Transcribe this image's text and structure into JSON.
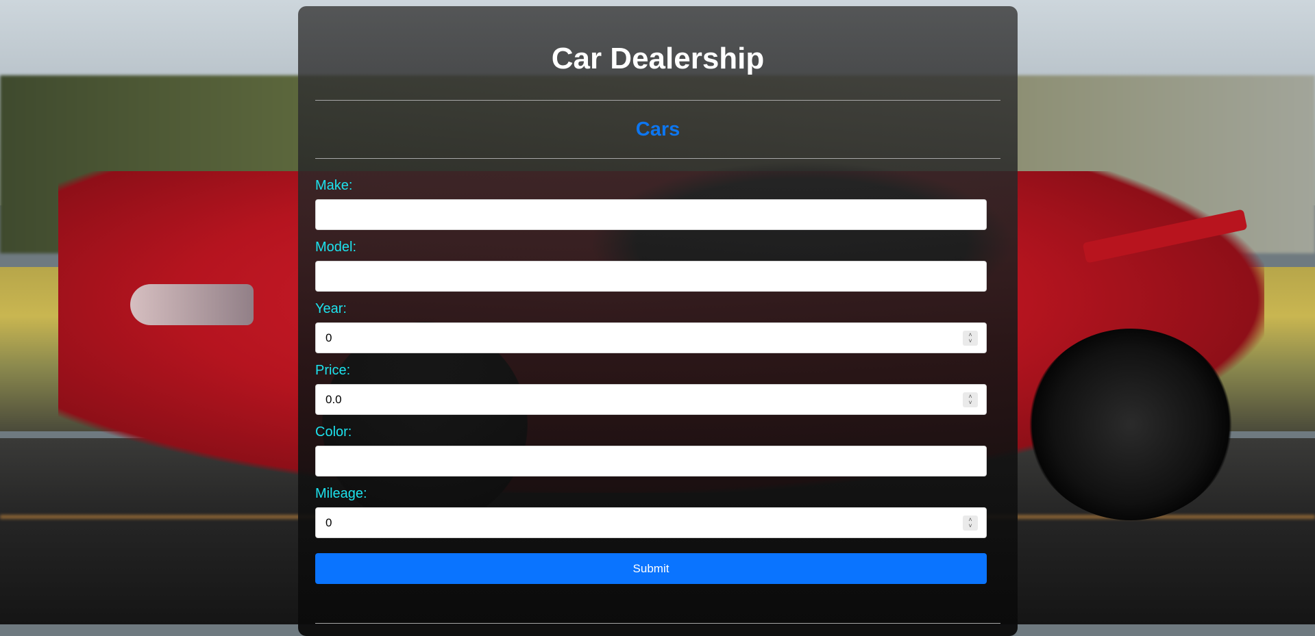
{
  "page": {
    "title": "Car Dealership",
    "section_title": "Cars"
  },
  "form": {
    "fields": [
      {
        "label": "Make:",
        "value": "",
        "type": "text"
      },
      {
        "label": "Model:",
        "value": "",
        "type": "text"
      },
      {
        "label": "Year:",
        "value": "0",
        "type": "number"
      },
      {
        "label": "Price:",
        "value": "0.0",
        "type": "number"
      },
      {
        "label": "Color:",
        "value": "",
        "type": "text"
      },
      {
        "label": "Mileage:",
        "value": "0",
        "type": "number"
      }
    ],
    "submit_label": "Submit"
  },
  "colors": {
    "label": "#1de3ee",
    "section_title": "#0d76f0",
    "submit_bg": "#0a74ff",
    "card_bg": "rgba(20,20,20,0.85)"
  },
  "icons": {
    "spinner": "up-down-chevron-icon"
  }
}
